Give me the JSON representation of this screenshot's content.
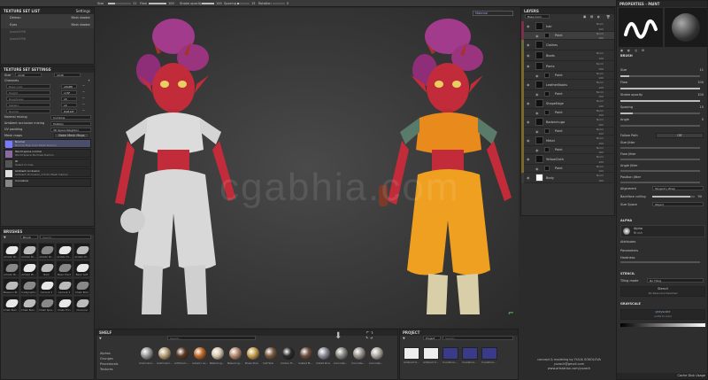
{
  "toolbar": {
    "size_label": "Size",
    "size_value": "11",
    "flow_label": "Flow",
    "flow_value": "100",
    "stroke_opacity_label": "Stroke opacity",
    "stroke_opacity_value": "100",
    "spacing_label": "Spacing",
    "spacing_value": "15",
    "angle_label": "Rotation",
    "angle_value": "0",
    "viewport_mode": "Material"
  },
  "texture_set_list": {
    "title": "TEXTURE SET LIST",
    "settings_label": "Settings",
    "items": [
      {
        "name": "Demon",
        "shader": "Main shader"
      },
      {
        "name": "Eyes",
        "shader": "Main shader"
      },
      {
        "name": "Jewel4998",
        "shader": ""
      },
      {
        "name": "jewel4998",
        "shader": ""
      }
    ]
  },
  "texture_set_settings": {
    "title": "TEXTURE SET SETTINGS",
    "size_label": "Size",
    "size_value": "2048",
    "size_value2": "2048",
    "channels_label": "Channels",
    "channels": [
      {
        "name": "Base color",
        "format": "sRGB8"
      },
      {
        "name": "Height",
        "format": "L16F"
      },
      {
        "name": "Roughness",
        "format": "L8"
      },
      {
        "name": "Metallic",
        "format": "L8"
      },
      {
        "name": "Normal",
        "format": "RGB16F"
      }
    ],
    "normal_mixing_label": "Normal mixing",
    "normal_mixing_value": "Combine",
    "ao_mixing_label": "Ambient occlusion mixing",
    "ao_mixing_value": "Multiply",
    "uv_padding_label": "UV padding",
    "uv_padding_value": "3D Space Neighbor",
    "mesh_maps_label": "Mesh maps",
    "bake_button": "Bake Mesh Maps",
    "maps": [
      {
        "name": "Normal",
        "sub": "Normal Map from Mesh Demon"
      },
      {
        "name": "World space normal",
        "sub": "World Space Normals Demon"
      },
      {
        "name": "ID",
        "sub": "Select id map"
      },
      {
        "name": "Ambient occlusion",
        "sub": "Ambient Occlusion_0 from Mesh Demon"
      },
      {
        "name": "Curvature",
        "sub": ""
      }
    ]
  },
  "brushes": {
    "title": "BRUSHES",
    "search_placeholder": "Search...",
    "filter_label": "Brush",
    "items": [
      "Artistic Br...",
      "Artistic Br...",
      "Artistic Br...",
      "Artistic Pr...",
      "Artistic Pr...",
      "Artistic Br...",
      "Artistic Br...",
      "Bark",
      "Basic Hard",
      "Basic Soft",
      "Bassoon Br...",
      "Calligraphic",
      "Cement 1",
      "Cement 2",
      "Chalk Bold",
      "Chalk Bum...",
      "Chalk Bum...",
      "Chalk Spre...",
      "Chalk Thin",
      "Charcoal"
    ]
  },
  "viewport": {
    "watermark": "cgabhia.com",
    "credit_line1": "concept & modeling by YULIA SOKOLOVA",
    "credit_line2": "yuzach@gmail.com",
    "credit_line3": "www.artstation.com/yuzach"
  },
  "shelf": {
    "title": "SHELF",
    "search_placeholder": "Search...",
    "categories": [
      "Alphas",
      "Grunges",
      "Procedurals",
      "Textures"
    ],
    "materials": [
      {
        "name": "Aluminium...",
        "color": "#9a9a9a"
      },
      {
        "name": "Aluminium...",
        "color": "#b9a27a"
      },
      {
        "name": "Artificial L...",
        "color": "#5a3a24"
      },
      {
        "name": "Autumn Le...",
        "color": "#c06a2a"
      },
      {
        "name": "Baked Lig...",
        "color": "#d8c8b0"
      },
      {
        "name": "Baked Lig...",
        "color": "#b58a70"
      },
      {
        "name": "Brass Pure",
        "color": "#c8a050"
      },
      {
        "name": "Calf Skin",
        "color": "#7a5a40"
      },
      {
        "name": "Carbon Fi...",
        "color": "#2a2a2a"
      },
      {
        "name": "Coated M...",
        "color": "#6e5040"
      },
      {
        "name": "Cobalt Pure",
        "color": "#8a8e96"
      },
      {
        "name": "Concrete...",
        "color": "#8a8a86"
      },
      {
        "name": "Concrete...",
        "color": "#9a968e"
      },
      {
        "name": "Concrete...",
        "color": "#b0aca2"
      }
    ]
  },
  "project": {
    "title": "PROJECT",
    "search_placeholder": "Search...",
    "filter_label": "Project",
    "items": [
      "Ambient O...",
      "Ambient O...",
      "Curvature...",
      "Curvature...",
      "Curvature..."
    ]
  },
  "layers": {
    "title": "LAYERS",
    "channel": "Base Color",
    "items": [
      {
        "name": "hair",
        "blend": "Norm",
        "opacity": "100",
        "color": "#7b2f4a",
        "indent": 0,
        "eye": true
      },
      {
        "name": "Paint",
        "blend": "Norm",
        "opacity": "100",
        "color": "#7b2f4a",
        "indent": 1,
        "eye": true
      },
      {
        "name": "Clothes",
        "blend": "",
        "opacity": "",
        "color": "#6a6a3a",
        "indent": 0,
        "eye": true
      },
      {
        "name": "Boots",
        "blend": "Norm",
        "opacity": "100",
        "color": "#7a6a2a",
        "indent": 0,
        "eye": true
      },
      {
        "name": "Pants",
        "blend": "Norm",
        "opacity": "100",
        "color": "#7a6a2a",
        "indent": 0,
        "eye": true
      },
      {
        "name": "Paint",
        "blend": "Norm",
        "opacity": "100",
        "color": "#7a6a2a",
        "indent": 1,
        "eye": true
      },
      {
        "name": "LeatherBooks",
        "blend": "Norm",
        "opacity": "100",
        "color": "#7a6a2a",
        "indent": 0,
        "eye": true
      },
      {
        "name": "Paint",
        "blend": "Norm",
        "opacity": "100",
        "color": "#7a6a2a",
        "indent": 1,
        "eye": true
      },
      {
        "name": "ShapeEdge",
        "blend": "Norm",
        "opacity": "100",
        "color": "#7a6a2a",
        "indent": 0,
        "eye": true
      },
      {
        "name": "Paint",
        "blend": "Norm",
        "opacity": "100",
        "color": "#7a6a2a",
        "indent": 1,
        "eye": true
      },
      {
        "name": "Barbechuga",
        "blend": "Norm",
        "opacity": "100",
        "color": "#7a6a2a",
        "indent": 0,
        "eye": true
      },
      {
        "name": "Paint",
        "blend": "Norm",
        "opacity": "100",
        "color": "#7a6a2a",
        "indent": 1,
        "eye": true
      },
      {
        "name": "Metal",
        "blend": "Norm",
        "opacity": "100",
        "color": "#7a6a2a",
        "indent": 0,
        "eye": true
      },
      {
        "name": "Paint",
        "blend": "Norm",
        "opacity": "100",
        "color": "#7a6a2a",
        "indent": 1,
        "eye": true
      },
      {
        "name": "YellowCloth",
        "blend": "Norm",
        "opacity": "100",
        "color": "#7a6a2a",
        "indent": 0,
        "eye": true
      },
      {
        "name": "Paint",
        "blend": "Norm",
        "opacity": "100",
        "color": "#7a6a2a",
        "indent": 1,
        "eye": true
      },
      {
        "name": "Body",
        "blend": "Norm",
        "opacity": "100",
        "color": "#3a3a3a",
        "indent": 0,
        "eye": true
      }
    ]
  },
  "properties": {
    "title": "PROPERTIES - PAINT",
    "brush_section": "BRUSH",
    "rows": [
      {
        "label": "Size",
        "value": "11"
      },
      {
        "label": "Flow",
        "value": "100"
      },
      {
        "label": "Stroke opacity",
        "value": "100"
      },
      {
        "label": "Spacing",
        "value": "15"
      },
      {
        "label": "Angle",
        "value": "0"
      }
    ],
    "follow_path_label": "Follow Path",
    "follow_path_value": "Off",
    "jitter_rows": [
      "Size Jitter",
      "Flow Jitter",
      "Angle Jitter",
      "Position Jitter"
    ],
    "alignment_label": "Alignment",
    "alignment_value": "Tangent | Wrap",
    "backface_label": "Backface culling",
    "backface_value": "90",
    "size_space_label": "Size Space",
    "size_space_value": "Object",
    "alpha_section": "ALPHA",
    "alpha_name": "Alpha",
    "alpha_sub": "Brush",
    "attributes_label": "Attributes",
    "parameters_label": "Parameters",
    "hardness_label": "Hardness",
    "stencil_section": "STENCIL",
    "tiling_label": "Tiling mode",
    "tiling_value": "No Tiling",
    "stencil_btn": "Stencil",
    "stencil_sub": "No Resource Selected",
    "grayscale_section": "GRAYSCALE",
    "grayscale_btn": "grayscale",
    "grayscale_sub": "uniform color",
    "status": "Cache Disk Usage"
  }
}
